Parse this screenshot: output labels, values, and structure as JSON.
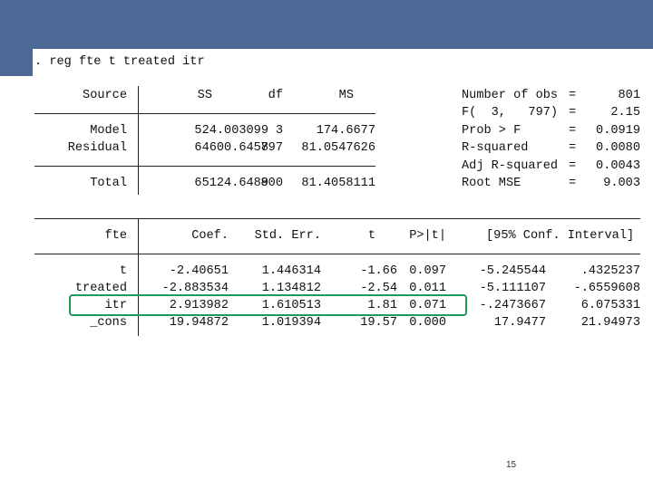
{
  "slide": {
    "command": ". reg fte t treated itr",
    "page_number": "15"
  },
  "anova": {
    "headers": [
      "Source",
      "SS",
      "df",
      "MS"
    ],
    "rows": [
      [
        "Model",
        "524.003099",
        "3",
        "174.6677"
      ],
      [
        "Residual",
        "64600.6458",
        "797",
        "81.0547626"
      ]
    ],
    "total": [
      "Total",
      "65124.6489",
      "800",
      "81.4058111"
    ]
  },
  "stats": [
    {
      "label": "Number of obs",
      "eq": "=",
      "value": "801"
    },
    {
      "label": "F(  3,   797)",
      "eq": "=",
      "value": "2.15"
    },
    {
      "label": "Prob > F",
      "eq": "=",
      "value": "0.0919"
    },
    {
      "label": "R-squared",
      "eq": "=",
      "value": "0.0080"
    },
    {
      "label": "Adj R-squared",
      "eq": "=",
      "value": "0.0043"
    },
    {
      "label": "Root MSE",
      "eq": "=",
      "value": "9.003"
    }
  ],
  "coef": {
    "headers": [
      "fte",
      "Coef.",
      "Std. Err.",
      "t",
      "P>|t|",
      "[95% Conf. Interval]"
    ],
    "rows": [
      [
        "t",
        "-2.40651",
        "1.446314",
        "-1.66",
        "0.097",
        "-5.245544",
        ".4325237"
      ],
      [
        "treated",
        "-2.883534",
        "1.134812",
        "-2.54",
        "0.011",
        "-5.111107",
        "-.6559608"
      ],
      [
        "itr",
        "2.913982",
        "1.610513",
        "1.81",
        "0.071",
        "-.2473667",
        "6.075331"
      ],
      [
        "_cons",
        "19.94872",
        "1.019394",
        "19.57",
        "0.000",
        "17.9477",
        "21.94973"
      ]
    ]
  },
  "highlight_color": "#1f9a5a"
}
